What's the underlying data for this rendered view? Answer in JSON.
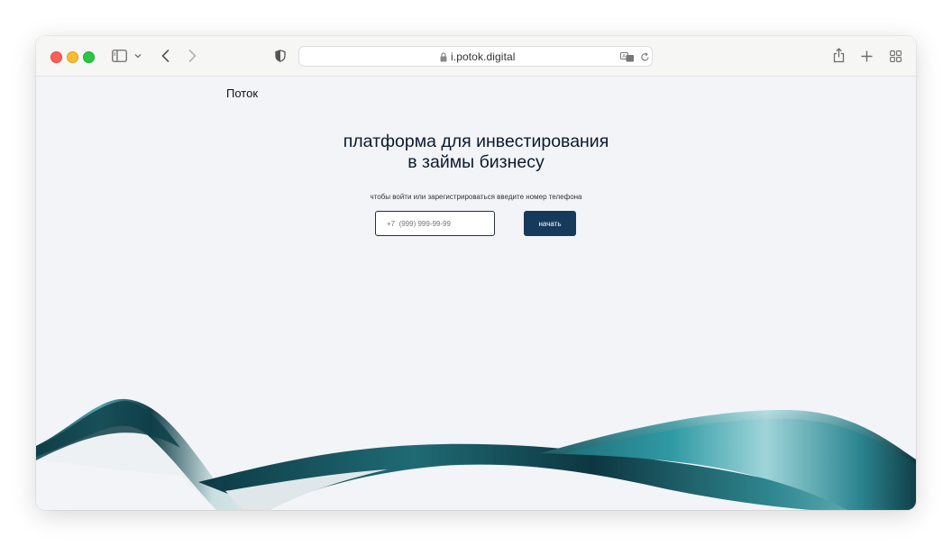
{
  "browser": {
    "url": "i.potok.digital",
    "icons": [
      "close-icon",
      "minimize-icon",
      "zoom-icon",
      "sidebar-icon",
      "chevron-down-icon",
      "back-icon",
      "forward-icon",
      "shield-icon",
      "lock-icon",
      "translate-icon",
      "reload-icon",
      "share-icon",
      "plus-icon",
      "tab-overview-icon"
    ]
  },
  "page": {
    "logo": "Поток",
    "headline_line1": "платформа для инвестирования",
    "headline_line2": "в займы бизнесу",
    "hint": "чтобы войти или зарегистрироваться введите номер телефона",
    "phone_placeholder": "+7  (999) 999-99-99",
    "start_label": "начать"
  },
  "colors": {
    "page_background": "#f3f4f8",
    "button": "#163a5c",
    "ribbon": "#1d5f6a"
  }
}
